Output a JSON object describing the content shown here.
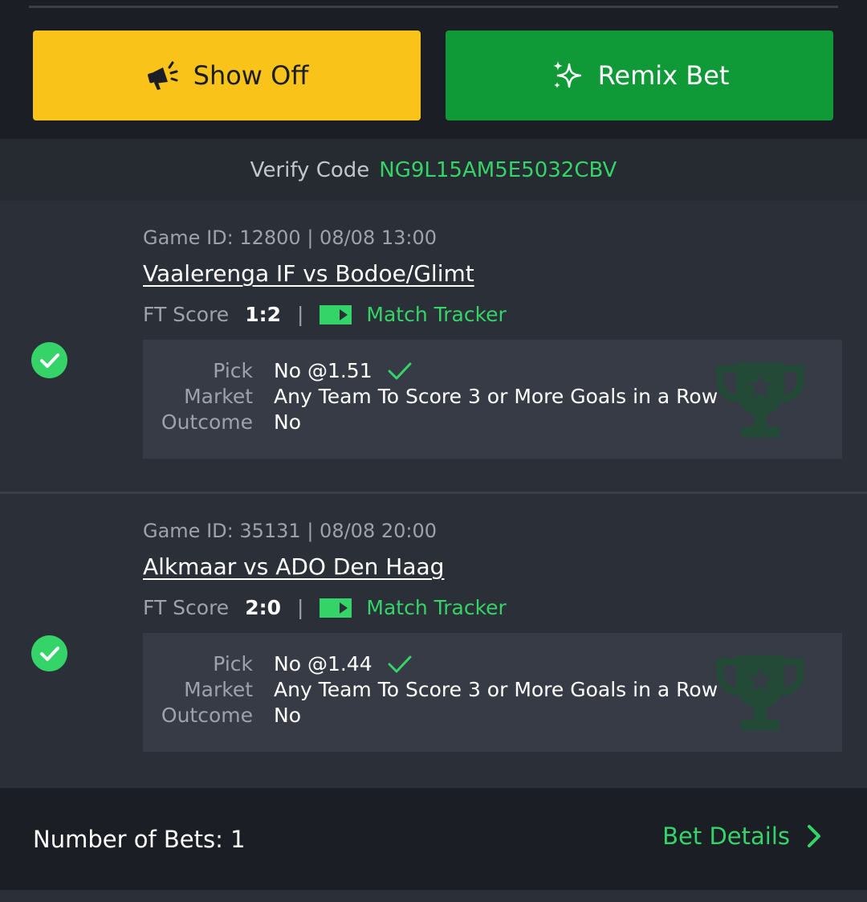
{
  "actions": {
    "show_off_label": "Show Off",
    "remix_label": "Remix Bet",
    "show_off_icon": "megaphone-icon",
    "remix_icon": "sparkles-icon"
  },
  "verify": {
    "label": "Verify Code",
    "code": "NG9L15AM5E5032CBV"
  },
  "games": [
    {
      "meta": "Game ID: 12800 | 08/08 13:00",
      "title": "Vaalerenga IF vs Bodoe/Glimt",
      "score_label": "FT Score",
      "score": "1:2",
      "separator": "|",
      "tracker_label": "Match Tracker",
      "pick_key": "Pick",
      "pick_val": "No @1.51",
      "market_key": "Market",
      "market_val": "Any Team To Score 3 or More Goals in a Row",
      "outcome_key": "Outcome",
      "outcome_val": "No",
      "status": "won"
    },
    {
      "meta": "Game ID: 35131 | 08/08 20:00",
      "title": "Alkmaar vs ADO Den Haag",
      "score_label": "FT Score",
      "score": "2:0",
      "separator": "|",
      "tracker_label": "Match Tracker",
      "pick_key": "Pick",
      "pick_val": "No @1.44",
      "market_key": "Market",
      "market_val": "Any Team To Score 3 or More Goals in a Row",
      "outcome_key": "Outcome",
      "outcome_val": "No",
      "status": "won"
    }
  ],
  "footer": {
    "count_label": "Number of Bets: 1",
    "details_label": "Bet Details"
  },
  "colors": {
    "accent_green": "#35d468",
    "show_off_bg": "#f9c31a",
    "remix_bg": "#0f9a37",
    "background": "#1b1e24",
    "card_bg": "#2b2f37"
  }
}
